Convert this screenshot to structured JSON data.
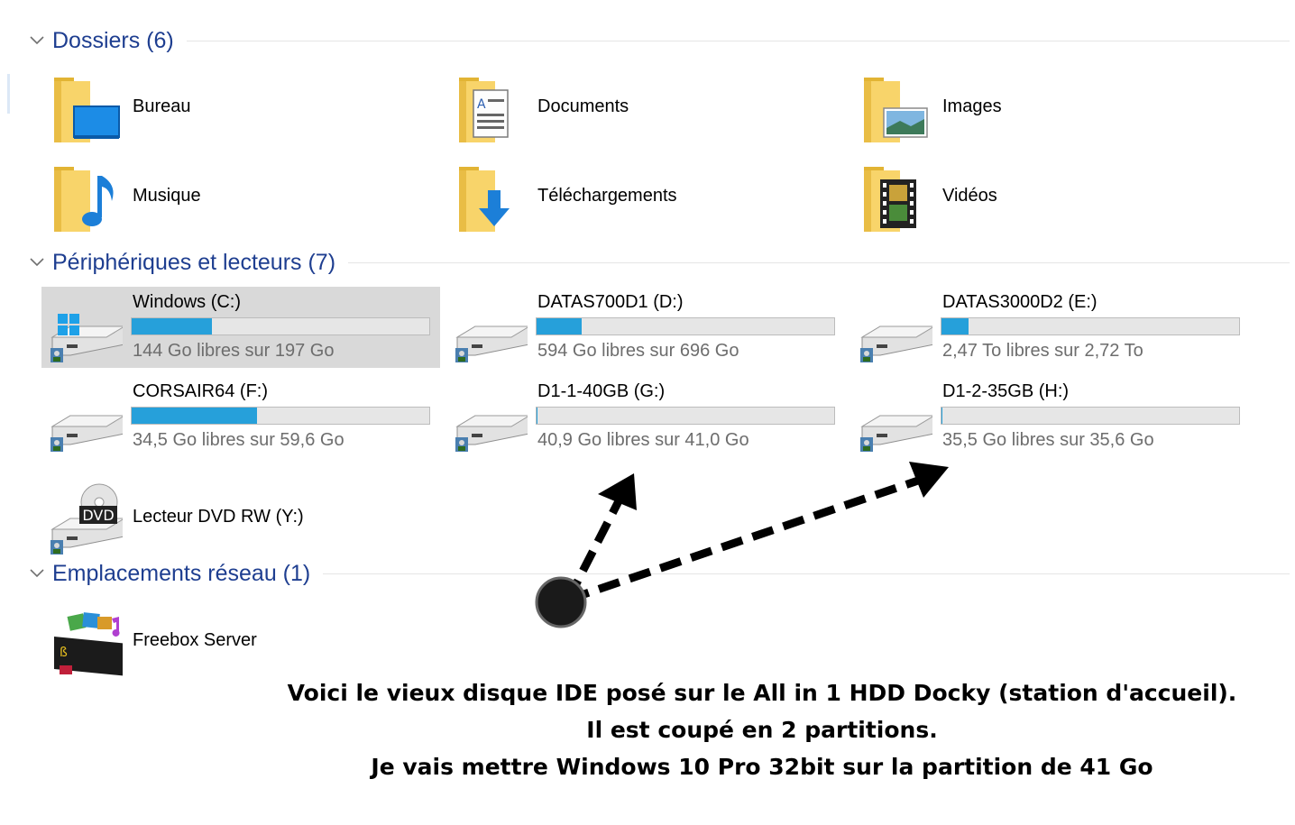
{
  "groups": {
    "folders": {
      "title": "Dossiers (6)",
      "chevron_icon": "chevron-down-icon"
    },
    "devices": {
      "title": "Périphériques et lecteurs (7)",
      "chevron_icon": "chevron-down-icon"
    },
    "network": {
      "title": "Emplacements réseau (1)",
      "chevron_icon": "chevron-down-icon"
    }
  },
  "folders": [
    {
      "label": "Bureau",
      "icon": "desktop-folder-icon"
    },
    {
      "label": "Documents",
      "icon": "documents-folder-icon"
    },
    {
      "label": "Images",
      "icon": "pictures-folder-icon"
    },
    {
      "label": "Musique",
      "icon": "music-folder-icon"
    },
    {
      "label": "Téléchargements",
      "icon": "downloads-folder-icon"
    },
    {
      "label": "Vidéos",
      "icon": "videos-folder-icon"
    }
  ],
  "drives": [
    {
      "label": "Windows (C:)",
      "free_text": "144 Go libres sur 197 Go",
      "used_fraction": 0.27,
      "icon": "windows-drive-icon",
      "selected": true
    },
    {
      "label": "DATAS700D1 (D:)",
      "free_text": "594 Go libres sur 696 Go",
      "used_fraction": 0.15,
      "icon": "hard-drive-icon"
    },
    {
      "label": "DATAS3000D2 (E:)",
      "free_text": "2,47 To libres sur 2,72 To",
      "used_fraction": 0.09,
      "icon": "hard-drive-icon"
    },
    {
      "label": "CORSAIR64 (F:)",
      "free_text": "34,5 Go libres sur 59,6 Go",
      "used_fraction": 0.42,
      "icon": "hard-drive-icon"
    },
    {
      "label": "D1-1-40GB (G:)",
      "free_text": "40,9 Go libres sur 41,0 Go",
      "used_fraction": 0.002,
      "icon": "hard-drive-icon"
    },
    {
      "label": "D1-2-35GB (H:)",
      "free_text": "35,5 Go libres sur 35,6 Go",
      "used_fraction": 0.003,
      "icon": "hard-drive-icon"
    }
  ],
  "dvd": {
    "label": "Lecteur DVD RW (Y:)",
    "icon": "dvd-drive-icon",
    "badge": "DVD"
  },
  "network_items": [
    {
      "label": "Freebox Server",
      "icon": "media-server-icon"
    }
  ],
  "annotation": {
    "line1": "Voici le vieux disque IDE posé sur le All in 1 HDD Docky (station d'accueil).",
    "line2": "Il est coupé en 2 partitions.",
    "line3": "Je vais mettre Windows 10 Pro 32bit sur la partition de 41 Go"
  },
  "colors": {
    "header_text": "#1e3e90",
    "bar_fill": "#26a0da",
    "selected_bg": "#d9d9d9",
    "folder_yellow": "#f8d46a"
  }
}
